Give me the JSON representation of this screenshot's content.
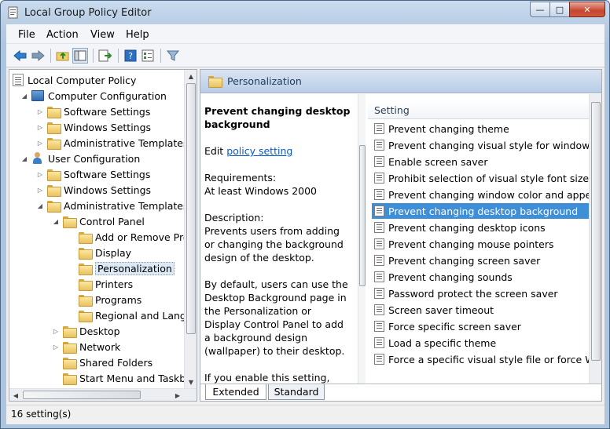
{
  "window": {
    "title": "Local Group Policy Editor",
    "minimize_glyph": "—",
    "maximize_glyph": "□",
    "close_glyph": "✕"
  },
  "menu": [
    "File",
    "Action",
    "View",
    "Help"
  ],
  "tree": {
    "nodes": [
      {
        "label": "Local Computer Policy",
        "icon": "policy-doc-icon",
        "toggle": ""
      },
      {
        "label": "Computer Configuration",
        "icon": "computer-icon",
        "toggle": "collapse"
      },
      {
        "label": "Software Settings",
        "icon": "folder-icon",
        "toggle": "expand"
      },
      {
        "label": "Windows Settings",
        "icon": "folder-icon",
        "toggle": "expand"
      },
      {
        "label": "Administrative Templates",
        "icon": "folder-icon",
        "toggle": "expand"
      },
      {
        "label": "User Configuration",
        "icon": "user-icon",
        "toggle": "collapse"
      },
      {
        "label": "Software Settings",
        "icon": "folder-icon",
        "toggle": "expand"
      },
      {
        "label": "Windows Settings",
        "icon": "folder-icon",
        "toggle": "expand"
      },
      {
        "label": "Administrative Templates",
        "icon": "folder-icon",
        "toggle": "collapse"
      },
      {
        "label": "Control Panel",
        "icon": "folder-icon",
        "toggle": "collapse"
      },
      {
        "label": "Add or Remove Pro",
        "icon": "folder-icon",
        "toggle": ""
      },
      {
        "label": "Display",
        "icon": "folder-icon",
        "toggle": ""
      },
      {
        "label": "Personalization",
        "icon": "folder-icon",
        "toggle": "",
        "selected": true
      },
      {
        "label": "Printers",
        "icon": "folder-icon",
        "toggle": ""
      },
      {
        "label": "Programs",
        "icon": "folder-icon",
        "toggle": ""
      },
      {
        "label": "Regional and Langu",
        "icon": "folder-icon",
        "toggle": ""
      },
      {
        "label": "Desktop",
        "icon": "folder-icon",
        "toggle": "expand"
      },
      {
        "label": "Network",
        "icon": "folder-icon",
        "toggle": "expand"
      },
      {
        "label": "Shared Folders",
        "icon": "folder-icon",
        "toggle": ""
      },
      {
        "label": "Start Menu and Taskb",
        "icon": "folder-icon",
        "toggle": ""
      }
    ]
  },
  "right_header": {
    "title": "Personalization"
  },
  "description": {
    "title": "Prevent changing desktop background",
    "edit_prefix": "Edit",
    "edit_link": "policy setting",
    "requirements_label": "Requirements:",
    "requirements_value": "At least Windows 2000",
    "description_label": "Description:",
    "description_text": "Prevents users from adding or changing the background design of the desktop.",
    "by_default_text": "By default, users can use the Desktop Background page in the Personalization or Display Control Panel to add a background design (wallpaper) to their desktop.",
    "if_enable_text": "If you enable this setting,"
  },
  "settings_list": {
    "column_header": "Setting",
    "items": [
      "Prevent changing theme",
      "Prevent changing visual style for windows and buttons",
      "Enable screen saver",
      "Prohibit selection of visual style font size",
      "Prevent changing window color and appearance",
      "Prevent changing desktop background",
      "Prevent changing desktop icons",
      "Prevent changing mouse pointers",
      "Prevent changing screen saver",
      "Prevent changing sounds",
      "Password protect the screen saver",
      "Screen saver timeout",
      "Force specific screen saver",
      "Load a specific theme",
      "Force a specific visual style file or force Windows Classic"
    ],
    "selected_index": 5
  },
  "tabs": [
    "Extended",
    "Standard"
  ],
  "active_tab": "Extended",
  "status": {
    "text": "16 setting(s)"
  },
  "colors": {
    "selection": "#3f8fd8",
    "link": "#0a5bc4",
    "header": "#b9cde6"
  }
}
